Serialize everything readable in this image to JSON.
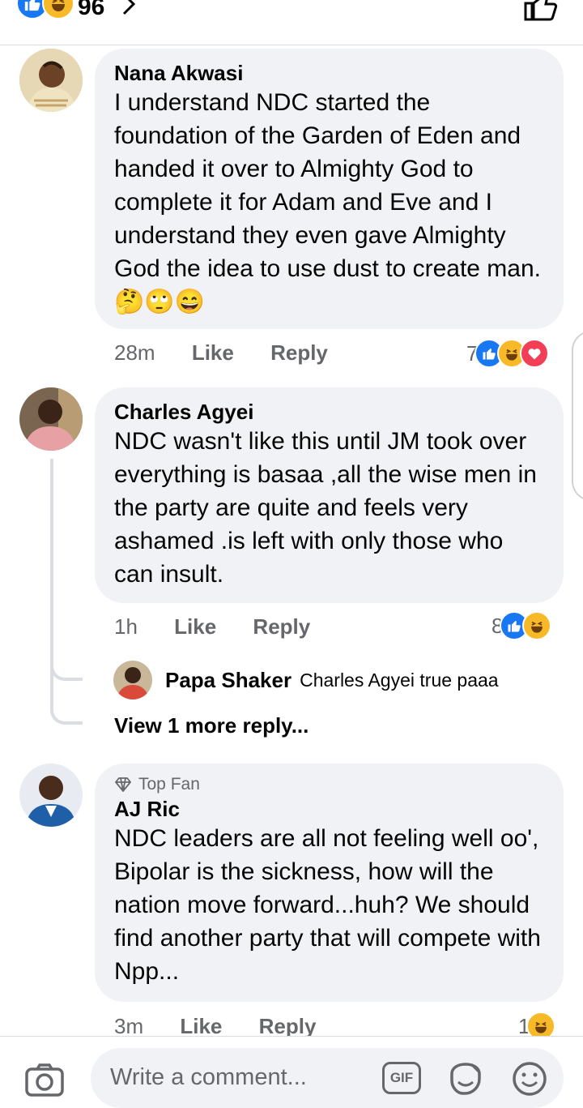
{
  "top": {
    "reaction_count": "96",
    "reactions": [
      "like-icon",
      "haha-icon"
    ]
  },
  "comments": [
    {
      "author": "Nana Akwasi",
      "text": "I understand NDC started the foundation of the Garden of Eden and handed it over to Almighty God to complete it for Adam and Eve and I understand they even gave Almighty God the idea to use dust to create man. 🤔🙄😄",
      "time": "28m",
      "like": "Like",
      "reply": "Reply",
      "reaction_count": "7",
      "reactions": [
        "like-icon",
        "haha-icon",
        "love-icon"
      ]
    },
    {
      "author": "Charles Agyei",
      "text": "NDC wasn't like this until JM took over everything is basaa ,all the wise men in the party are quite and feels very ashamed .is left with only those who can insult.",
      "time": "1h",
      "like": "Like",
      "reply": "Reply",
      "reaction_count": "8",
      "reactions": [
        "like-icon",
        "haha-icon"
      ],
      "reply_preview": {
        "author": "Papa Shaker",
        "text": "Charles Agyei true paaa"
      },
      "view_more": "View 1 more reply..."
    },
    {
      "badge": "Top Fan",
      "author": "AJ Ric",
      "text": "NDC leaders are all not feeling well oo', Bipolar is the sickness, how will the nation move forward...huh? We should find another party that will compete with Npp...",
      "time": "3m",
      "like": "Like",
      "reply": "Reply",
      "reaction_count": "1",
      "reactions": [
        "haha-icon"
      ]
    }
  ],
  "composer": {
    "placeholder": "Write a comment...",
    "gif_label": "GIF"
  },
  "colors": {
    "bubble": "#f0f2f5",
    "meta_text": "#65676b",
    "like_blue": "#1877f2",
    "haha_yellow": "#f7b928",
    "love_red": "#f33e58"
  }
}
